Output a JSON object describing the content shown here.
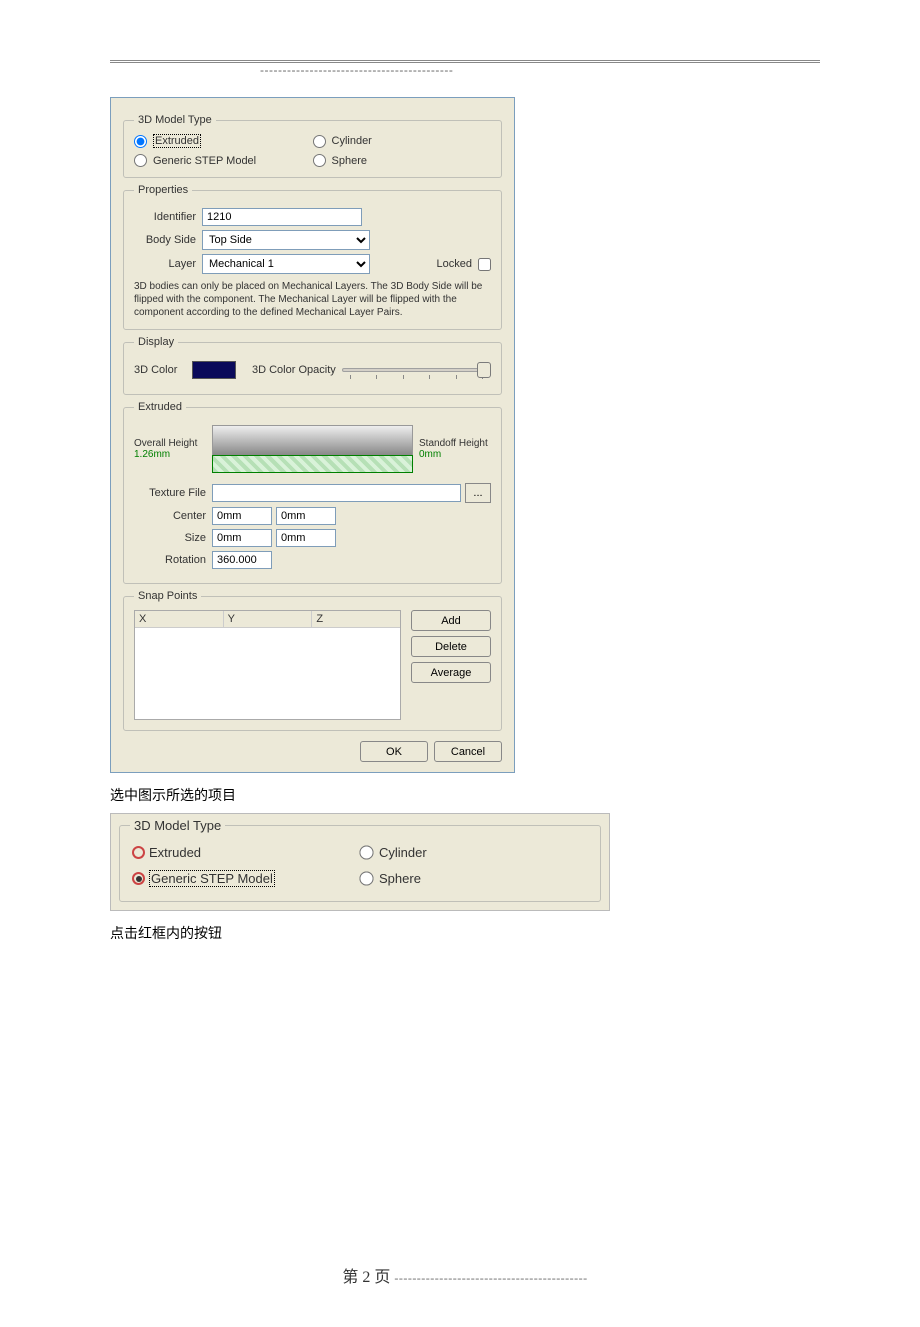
{
  "top_dashes": "-------------------------------------------",
  "dialog": {
    "model_type": {
      "legend": "3D Model Type",
      "extruded": "Extruded",
      "cylinder": "Cylinder",
      "generic_step": "Generic STEP Model",
      "sphere": "Sphere"
    },
    "properties": {
      "legend": "Properties",
      "identifier_label": "Identifier",
      "identifier_value": "1210",
      "body_side_label": "Body Side",
      "body_side_value": "Top Side",
      "layer_label": "Layer",
      "layer_value": "Mechanical 1",
      "locked_label": "Locked",
      "hint": "3D bodies can only be placed on Mechanical Layers. The 3D Body Side will be flipped with the component. The Mechanical Layer will be flipped with the component according to the defined Mechanical Layer Pairs."
    },
    "display": {
      "legend": "Display",
      "color_label": "3D Color",
      "opacity_label": "3D Color Opacity"
    },
    "extruded": {
      "legend": "Extruded",
      "overall_height_label": "Overall Height",
      "overall_height_value": "1.26mm",
      "standoff_height_label": "Standoff Height",
      "standoff_height_value": "0mm",
      "texture_file_label": "Texture File",
      "browse": "...",
      "center_label": "Center",
      "center_x": "0mm",
      "center_y": "0mm",
      "size_label": "Size",
      "size_x": "0mm",
      "size_y": "0mm",
      "rotation_label": "Rotation",
      "rotation_value": "360.000"
    },
    "snap_points": {
      "legend": "Snap Points",
      "col_x": "X",
      "col_y": "Y",
      "col_z": "Z",
      "add": "Add",
      "delete": "Delete",
      "average": "Average"
    },
    "actions": {
      "ok": "OK",
      "cancel": "Cancel"
    }
  },
  "caption1": "选中图示所选的项目",
  "dialog2": {
    "legend": "3D Model Type",
    "extruded": "Extruded",
    "cylinder": "Cylinder",
    "generic_step": "Generic STEP Model",
    "sphere": "Sphere"
  },
  "caption2": "点击红框内的按钮",
  "footer": {
    "page_label": "第 2 页",
    "dashes": "-------------------------------------------"
  }
}
